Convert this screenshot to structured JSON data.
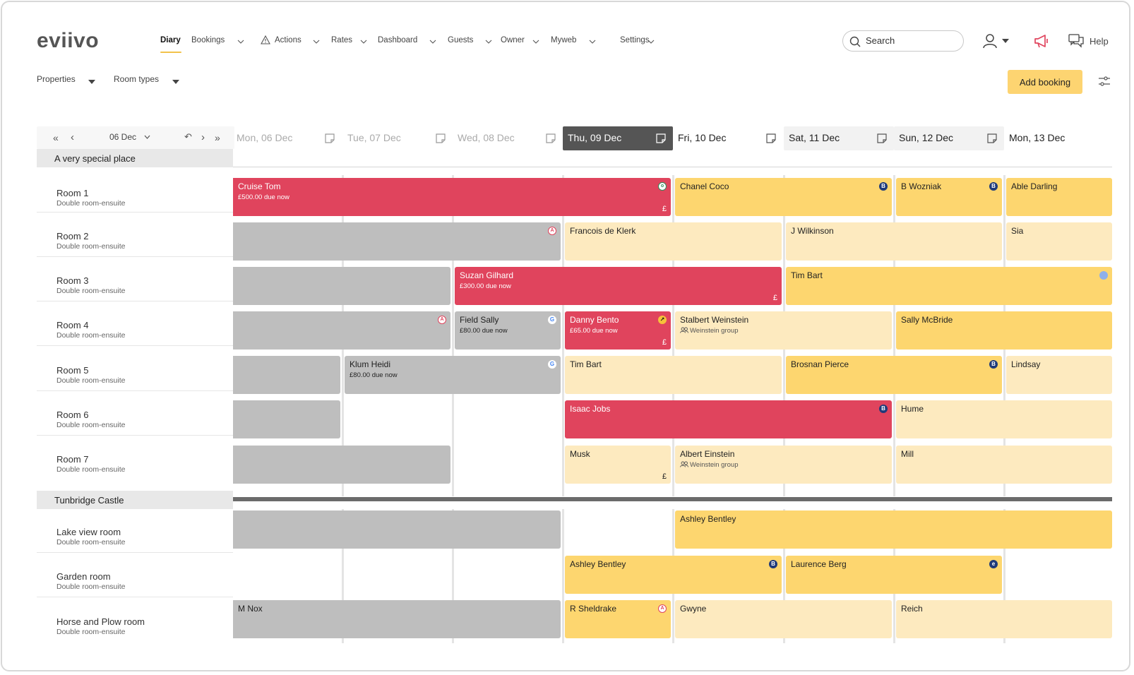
{
  "app": {
    "logo": "eviivo"
  },
  "nav": [
    {
      "label": "Diary",
      "active": true,
      "dropdown": false
    },
    {
      "label": "Bookings",
      "dropdown": true
    },
    {
      "label": "Actions",
      "dropdown": true,
      "icon": "warning-icon"
    },
    {
      "label": "Rates",
      "dropdown": true
    },
    {
      "label": "Dashboard",
      "dropdown": true
    },
    {
      "label": "Guests",
      "dropdown": true
    },
    {
      "label": "Owner",
      "dropdown": true
    },
    {
      "label": "Myweb",
      "dropdown": true
    },
    {
      "label": "Settings",
      "dropdown": true
    }
  ],
  "header": {
    "search_placeholder": "Search",
    "help": "Help"
  },
  "filters": {
    "properties": "Properties",
    "room_types": "Room types"
  },
  "add_booking": "Add booking",
  "date_nav": {
    "current": "06 Dec"
  },
  "days": [
    {
      "label": "Mon, 06 Dec",
      "state": "past"
    },
    {
      "label": "Tue, 07 Dec",
      "state": "past"
    },
    {
      "label": "Wed, 08 Dec",
      "state": "past"
    },
    {
      "label": "Thu, 09 Dec",
      "state": "today"
    },
    {
      "label": "Fri, 10 Dec",
      "state": "future"
    },
    {
      "label": "Sat, 11 Dec",
      "state": "weekend"
    },
    {
      "label": "Sun, 12 Dec",
      "state": "weekend"
    },
    {
      "label": "Mon, 13 Dec",
      "state": "future"
    }
  ],
  "properties": [
    {
      "name": "A very special place",
      "rooms": [
        {
          "name": "Room 1",
          "type": "Double room-ensuite"
        },
        {
          "name": "Room 2",
          "type": "Double room-ensuite"
        },
        {
          "name": "Room 3",
          "type": "Double room-ensuite"
        },
        {
          "name": "Room 4",
          "type": "Double room-ensuite"
        },
        {
          "name": "Room 5",
          "type": "Double room-ensuite"
        },
        {
          "name": "Room 6",
          "type": "Double room-ensuite"
        },
        {
          "name": "Room 7",
          "type": "Double room-ensuite"
        }
      ]
    },
    {
      "name": "Tunbridge Castle",
      "rooms": [
        {
          "name": "Lake view room",
          "type": "Double room-ensuite"
        },
        {
          "name": "Garden room",
          "type": "Double room-ensuite"
        },
        {
          "name": "Horse and Plow room",
          "type": "Double room-ensuite"
        }
      ]
    }
  ],
  "bookings": [
    {
      "row": 0,
      "start": 0,
      "end": 4,
      "color": "red",
      "name": "Cruise Tom",
      "sub": "£500.00 due now",
      "badge": "green",
      "pound": true
    },
    {
      "row": 0,
      "start": 4,
      "end": 6,
      "color": "yellow",
      "name": "Chanel Coco",
      "badge": "B"
    },
    {
      "row": 0,
      "start": 6,
      "end": 7,
      "color": "yellow",
      "name": "B Wozniak",
      "badge": "B"
    },
    {
      "row": 0,
      "start": 7,
      "end": 8,
      "color": "yellow",
      "name": "Able Darling"
    },
    {
      "row": 1,
      "start": 0,
      "end": 3,
      "color": "grey",
      "name": "",
      "badge": "air"
    },
    {
      "row": 1,
      "start": 3,
      "end": 5,
      "color": "light",
      "name": "Francois de Klerk"
    },
    {
      "row": 1,
      "start": 5,
      "end": 7,
      "color": "light",
      "name": "J Wilkinson"
    },
    {
      "row": 1,
      "start": 7,
      "end": 8,
      "color": "light",
      "name": "Sia"
    },
    {
      "row": 2,
      "start": 0,
      "end": 2,
      "color": "grey",
      "name": ""
    },
    {
      "row": 2,
      "start": 2,
      "end": 5,
      "color": "red",
      "name": "Suzan Gilhard",
      "sub": "£300.00 due now",
      "pound": true
    },
    {
      "row": 2,
      "start": 5,
      "end": 8,
      "color": "yellow",
      "name": "Tim Bart",
      "badge": "blue"
    },
    {
      "row": 3,
      "start": 0,
      "end": 2,
      "color": "grey",
      "name": "",
      "badge": "air"
    },
    {
      "row": 3,
      "start": 2,
      "end": 3,
      "color": "grey",
      "name": "Field Sally",
      "sub": "£80.00 due now",
      "badge": "G"
    },
    {
      "row": 3,
      "start": 3,
      "end": 4,
      "color": "red",
      "name": "Danny Bento",
      "sub": "£65.00 due now",
      "badge": "arrow",
      "pound": true
    },
    {
      "row": 3,
      "start": 4,
      "end": 6,
      "color": "light",
      "name": "Stalbert Weinstein",
      "group": "Weinstein group"
    },
    {
      "row": 3,
      "start": 6,
      "end": 8,
      "color": "yellow",
      "name": "Sally McBride"
    },
    {
      "row": 4,
      "start": 0,
      "end": 1,
      "color": "grey",
      "name": ""
    },
    {
      "row": 4,
      "start": 1,
      "end": 3,
      "color": "grey",
      "name": "Klum Heidi",
      "sub": "£80.00 due now",
      "badge": "G"
    },
    {
      "row": 4,
      "start": 3,
      "end": 5,
      "color": "light",
      "name": "Tim Bart"
    },
    {
      "row": 4,
      "start": 5,
      "end": 7,
      "color": "yellow",
      "name": "Brosnan Pierce",
      "badge": "B"
    },
    {
      "row": 4,
      "start": 7,
      "end": 8,
      "color": "light",
      "name": "Lindsay"
    },
    {
      "row": 5,
      "start": 0,
      "end": 1,
      "color": "grey",
      "name": ""
    },
    {
      "row": 5,
      "start": 3,
      "end": 6,
      "color": "red",
      "name": "Isaac Jobs",
      "badge": "B"
    },
    {
      "row": 5,
      "start": 6,
      "end": 8,
      "color": "light",
      "name": "Hume"
    },
    {
      "row": 6,
      "start": 0,
      "end": 2,
      "color": "grey",
      "name": ""
    },
    {
      "row": 6,
      "start": 3,
      "end": 4,
      "color": "light",
      "name": "Musk",
      "pound": true
    },
    {
      "row": 6,
      "start": 4,
      "end": 6,
      "color": "light",
      "name": "Albert Einstein",
      "group": "Weinstein group"
    },
    {
      "row": 6,
      "start": 6,
      "end": 8,
      "color": "light",
      "name": "Mill"
    },
    {
      "row": 7,
      "start": 0,
      "end": 3,
      "color": "grey",
      "name": ""
    },
    {
      "row": 7,
      "start": 4,
      "end": 8,
      "color": "yellow",
      "name": "Ashley Bentley"
    },
    {
      "row": 8,
      "start": 3,
      "end": 5,
      "color": "yellow",
      "name": "Ashley Bentley",
      "badge": "B"
    },
    {
      "row": 8,
      "start": 5,
      "end": 7,
      "color": "yellow",
      "name": "Laurence Berg",
      "badge": "e"
    },
    {
      "row": 9,
      "start": 0,
      "end": 3,
      "color": "grey",
      "name": "M Nox"
    },
    {
      "row": 9,
      "start": 3,
      "end": 4,
      "color": "yellow",
      "name": "R Sheldrake",
      "badge": "air"
    },
    {
      "row": 9,
      "start": 4,
      "end": 6,
      "color": "light",
      "name": "Gwyne"
    },
    {
      "row": 9,
      "start": 6,
      "end": 8,
      "color": "light",
      "name": "Reich"
    }
  ]
}
